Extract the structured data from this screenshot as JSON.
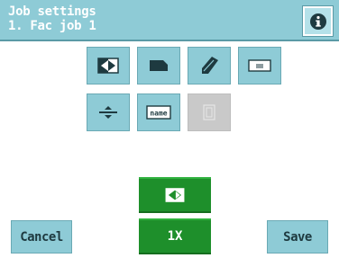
{
  "header": {
    "title": "Job settings",
    "subtitle": "1. Fac job 1",
    "info_icon": "info-icon"
  },
  "tiles": [
    {
      "name": "fold-settings-icon",
      "enabled": true
    },
    {
      "name": "envelope-icon",
      "enabled": true
    },
    {
      "name": "sealer-icon",
      "enabled": true
    },
    {
      "name": "barcode-reader-icon",
      "enabled": true
    },
    {
      "name": "separator-icon",
      "enabled": true
    },
    {
      "name": "name-label-icon",
      "enabled": true,
      "label": "name"
    },
    {
      "name": "disabled-feeder-icon",
      "enabled": false
    }
  ],
  "run": {
    "start_icon": "start-run-icon",
    "count_label": "1X"
  },
  "footer": {
    "cancel_label": "Cancel",
    "save_label": "Save"
  },
  "colors": {
    "header": "#8ecbd6",
    "tile": "#8ecbd6",
    "tile_disabled": "#c9c9c9",
    "green": "#1e8f2b",
    "icon_dark": "#1e3a40"
  }
}
